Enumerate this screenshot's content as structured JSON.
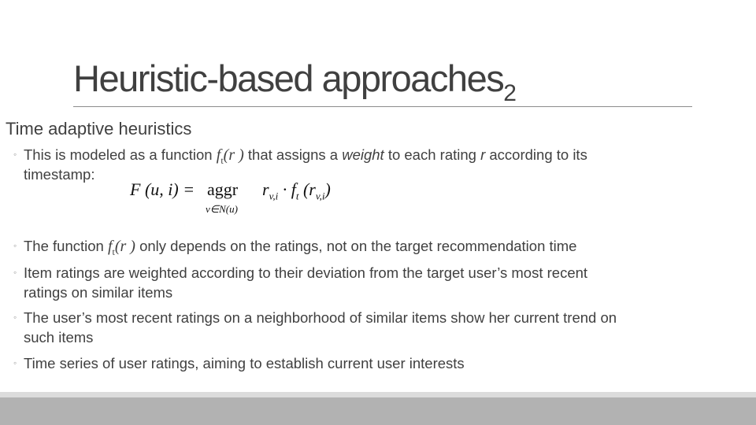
{
  "slide": {
    "title": "Heuristic-based approaches",
    "title_subscript": "2",
    "level1": "Time adaptive heuristics",
    "bullets": [
      {
        "parts": [
          {
            "text": "This is modeled as a function ",
            "style": "normal"
          },
          {
            "text": "ft(r )",
            "style": "math"
          },
          {
            "text": " that assigns a ",
            "style": "normal"
          },
          {
            "text": "weight",
            "style": "italic"
          },
          {
            "text": " to each rating ",
            "style": "normal"
          },
          {
            "text": "r",
            "style": "italic"
          },
          {
            "text": " according to its",
            "style": "normal"
          }
        ],
        "continuation": "timestamp:"
      },
      {
        "parts": [
          {
            "text": "The function ",
            "style": "normal"
          },
          {
            "text": "ft(r )",
            "style": "math"
          },
          {
            "text": " only depends on the ratings, not on the target recommendation time",
            "style": "normal"
          }
        ]
      },
      {
        "text": "Item ratings are weighted according to their deviation from the target user’s most recent",
        "continuation": "ratings on similar items"
      },
      {
        "text": "The user’s most recent ratings on a neighborhood of similar items show her current trend on",
        "continuation": "such items"
      },
      {
        "text": "Time series of user ratings, aiming to establish current user interests"
      }
    ],
    "formula": {
      "lhs": "F (u, i) =",
      "operator": "aggr",
      "operator_under": "v∈N(u)",
      "rhs": "r_{v,i} · f_t (r_{v,i})"
    },
    "bullet_symbol": "◦"
  },
  "colors": {
    "text": "#404040",
    "rule": "#8c8c8c",
    "footer_light": "#dcdcdc",
    "footer_dark": "#b2b2b2"
  }
}
